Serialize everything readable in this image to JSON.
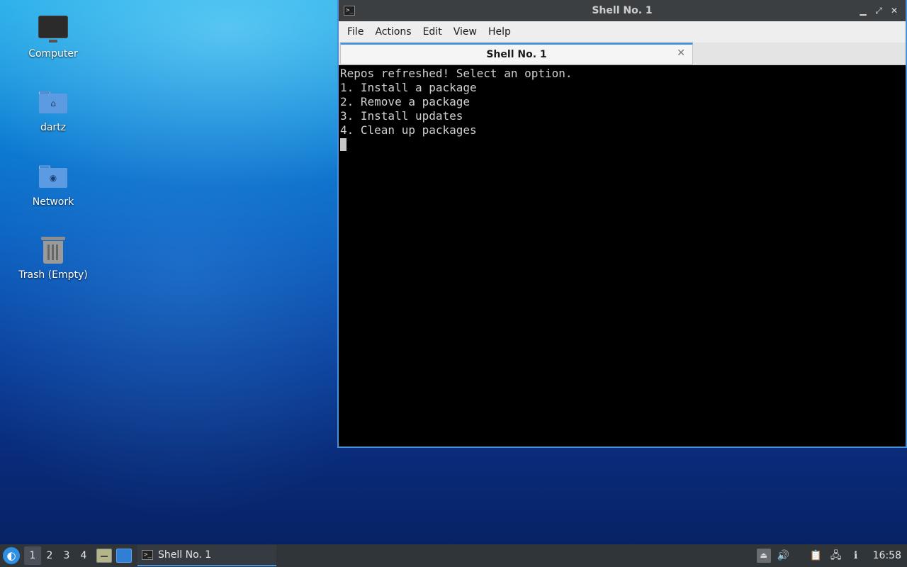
{
  "desktop": {
    "icons": [
      {
        "label": "Computer",
        "icon": "computer-icon"
      },
      {
        "label": "dartz",
        "icon": "home-folder-icon",
        "glyph": "⌂"
      },
      {
        "label": "Network",
        "icon": "network-folder-icon",
        "glyph": "◉"
      },
      {
        "label": "Trash (Empty)",
        "icon": "trash-icon"
      }
    ]
  },
  "window": {
    "title": "Shell No. 1",
    "icon": "terminal-icon",
    "icon_glyph": ">_",
    "controls": {
      "minimize": "▁",
      "maximize": "⤢",
      "close": "✕"
    },
    "menu": [
      "File",
      "Actions",
      "Edit",
      "View",
      "Help"
    ],
    "tab": {
      "label": "Shell No. 1",
      "close": "✕"
    },
    "terminal_lines": [
      "Repos refreshed! Select an option.",
      "1. Install a package",
      "2. Remove a package",
      "3. Install updates",
      "4. Clean up packages"
    ]
  },
  "taskbar": {
    "start_glyph": "◐",
    "workspaces": [
      "1",
      "2",
      "3",
      "4"
    ],
    "active_workspace": "1",
    "task": {
      "label": "Shell No. 1",
      "icon_glyph": ">_"
    },
    "tray": {
      "eject": "⏏",
      "volume": "🔊",
      "clipboard": "📋",
      "network": "🖧",
      "update": "ℹ"
    },
    "clock": "16:58"
  },
  "colors": {
    "accent": "#4a90d9",
    "titlebar": "#3c3f41",
    "taskbar": "#30353a",
    "terminal_bg": "#000000"
  }
}
